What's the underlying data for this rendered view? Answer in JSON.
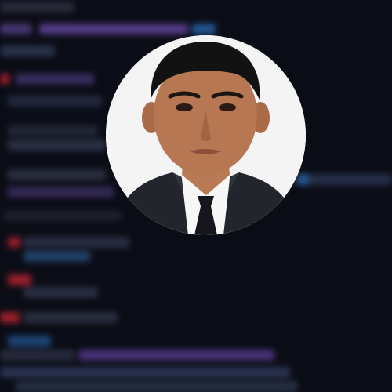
{
  "page": {
    "background_color": "#0b0d16"
  },
  "background_code": {
    "style": "blurred-code-editor"
  },
  "avatar": {
    "shape": "circle",
    "background_color": "#f4f4f4",
    "subject": "portrait-suit-tie"
  }
}
